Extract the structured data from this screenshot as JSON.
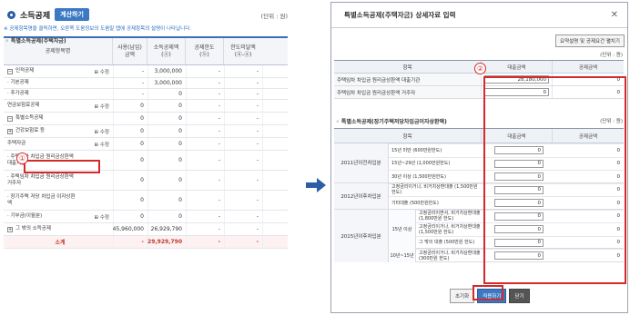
{
  "left": {
    "title": "소득공제",
    "calc_button": "계산하기",
    "unit": "(단위 : 원)",
    "note": "※ 공제항목명을 클릭하면, 오른쪽 도움정보의 도움말 탭에 공제항목의 설명이 나타납니다.",
    "headers": [
      "공제항목명",
      "사용(납입)\n금액",
      "소득공제액\n(ⓐ)",
      "공제한도\n(ⓑ)",
      "한도미달액\n(ⓑ-ⓐ)"
    ],
    "edit_label": "⊞ 수정",
    "rows": [
      {
        "toggle": "−",
        "name": "인적공제",
        "edit": true,
        "v": [
          "-",
          "3,000,000",
          "-",
          "-"
        ]
      },
      {
        "toggle": "",
        "name": "· 기본공제",
        "edit": false,
        "v": [
          "-",
          "3,000,000",
          "-",
          "-"
        ]
      },
      {
        "toggle": "",
        "name": "· 추가공제",
        "edit": false,
        "v": [
          "-",
          "0",
          "-",
          "-"
        ]
      },
      {
        "toggle": "",
        "name": "연금보험료공제",
        "edit": true,
        "v": [
          "0",
          "0",
          "-",
          "-"
        ]
      },
      {
        "toggle": "−",
        "name": "특별소득공제",
        "edit": false,
        "v": [
          "0",
          "0",
          "-",
          "-"
        ]
      },
      {
        "toggle": "+",
        "name": "건강보험료 등",
        "edit": true,
        "v": [
          "0",
          "0",
          "-",
          "-"
        ]
      },
      {
        "toggle": "",
        "name": "주택자금",
        "edit": true,
        "v": [
          "0",
          "0",
          "-",
          "-"
        ]
      },
      {
        "toggle": "",
        "name": "· 주택임차 차입금 원리금상환액 대출기관",
        "edit": false,
        "v": [
          "0",
          "0",
          "-",
          "-"
        ]
      },
      {
        "toggle": "",
        "name": "· 주택임차 차입금 원리금상환액 거주자",
        "edit": false,
        "v": [
          "0",
          "0",
          "-",
          "-"
        ]
      },
      {
        "toggle": "",
        "name": "· 장기주택 저당 차입금 이자상환액",
        "edit": false,
        "v": [
          "0",
          "0",
          "-",
          "-"
        ]
      },
      {
        "toggle": "",
        "name": "· 기부금(이월분)",
        "edit": true,
        "v": [
          "0",
          "0",
          "-",
          "-"
        ]
      },
      {
        "toggle": "+",
        "name": "그 밖의 소득공제",
        "edit": false,
        "v": [
          "45,960,000",
          "26,929,790",
          "-",
          "-"
        ]
      }
    ],
    "total": {
      "name": "소계",
      "v": [
        "-",
        "29,929,790",
        "-",
        "-"
      ]
    },
    "marker": "①"
  },
  "modal": {
    "title": "특별소득공제(주택자금) 상세자료 입력",
    "close": "✕",
    "section1": "◦ 특별소득공제(주택자금)",
    "guide_button": "요약설명 및 공제요건 펼치기",
    "unit1": "(단위 : 원)",
    "t1_headers": [
      "항목",
      "대출금액",
      "공제금액"
    ],
    "t1_rows": [
      {
        "label": "주택임차 차입금 원리금상환액 대출기관",
        "amount": "28,180,000",
        "deduct": "0"
      },
      {
        "label": "주택임차 차입금 원리금상환액 거주자",
        "amount": "0",
        "deduct": "0"
      }
    ],
    "section2": "◦ 특별소득공제(장기주택저당차입금이자상환액)",
    "unit2": "(단위 : 원)",
    "t2_headers": [
      "항목",
      "대출금액",
      "공제금액"
    ],
    "groups": [
      {
        "label": "2011년이전차입분",
        "lines": [
          "15년 미만 (600만원한도)",
          "15년~29년 (1,000만원한도)",
          "30년 이상 (1,500만원한도)"
        ]
      },
      {
        "label": "2012년이후차입분",
        "lines": [
          "고정금리이거나, 비거치상환대출 (1,500만원한도)",
          "기타대출 (500만원한도)"
        ]
      },
      {
        "label": "2015년이후차입분",
        "sub": "15년 이상",
        "lines": [
          "고정금리이면서, 비거치상환대출 (1,800만원 한도)",
          "고정금리이거나, 비거치상환대출 (1,500만원 한도)",
          "그 밖의 대출 (500만원 한도)"
        ]
      },
      {
        "label": "",
        "sub": "10년~15년",
        "lines": [
          "고정금리이거나, 비거치상환대출 (300만원 한도)"
        ]
      }
    ],
    "line_values": {
      "amount": "0",
      "deduct": "0"
    },
    "buttons": {
      "reset": "초기화",
      "apply": "적용하기",
      "close": "닫기"
    },
    "marker": "②"
  }
}
